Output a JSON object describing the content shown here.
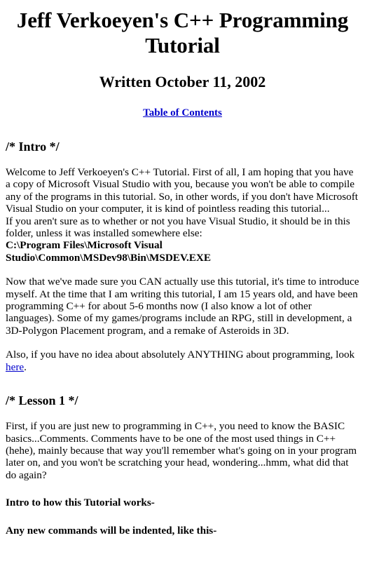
{
  "document": {
    "title": "Jeff Verkoeyen's C++ Programming Tutorial",
    "subtitle": "Written October 11, 2002",
    "toc_link_label": "Table of Contents"
  },
  "sections": {
    "intro": {
      "heading": "/* Intro */",
      "paragraph_1_part_a": "Welcome to Jeff Verkoeyen's C++ Tutorial. First of all, I am hoping that you have a copy of Microsoft Visual Studio with you, because you won't be able to compile any of the programs in this tutorial. So, in other words, if you don't have Microsoft Visual Studio on your computer, it is kind of pointless reading this tutorial...",
      "paragraph_1_part_b": "If you aren't sure as to whether or not you have Visual Studio, it should be in this folder, unless it was installed somewhere else:",
      "install_path": "C:\\Program Files\\Microsoft Visual Studio\\Common\\MSDev98\\Bin\\MSDEV.EXE",
      "paragraph_2": "Now that we've made sure you CAN actually use this tutorial, it's time to introduce myself. At the time that I am writing this tutorial, I am 15 years old, and have been programming C++ for about 5-6 months now (I also know a lot of other languages). Some of my games/programs include an RPG, still in development, a 3D-Polygon Placement program, and a remake of Asteroids in 3D.",
      "paragraph_3_before_link": "Also, if you have no idea about absolutely ANYTHING about programming, look ",
      "paragraph_3_link_label": "here",
      "paragraph_3_after_link": "."
    },
    "lesson_1": {
      "heading": "/* Lesson 1 */",
      "paragraph_1": "First, if you are just new to programming in C++, you need to know the BASIC basics...Comments. Comments have to be one of the most used things in C++ (hehe), mainly because that way you'll remember what's going on in your program later on, and you won't be scratching your head, wondering...hmm, what did that do again?",
      "note_1": "Intro to how this Tutorial works-",
      "note_2": "Any new commands will be indented, like this-"
    }
  },
  "colors": {
    "background": "#ffffff",
    "text": "#000000",
    "link": "#0000cc"
  }
}
